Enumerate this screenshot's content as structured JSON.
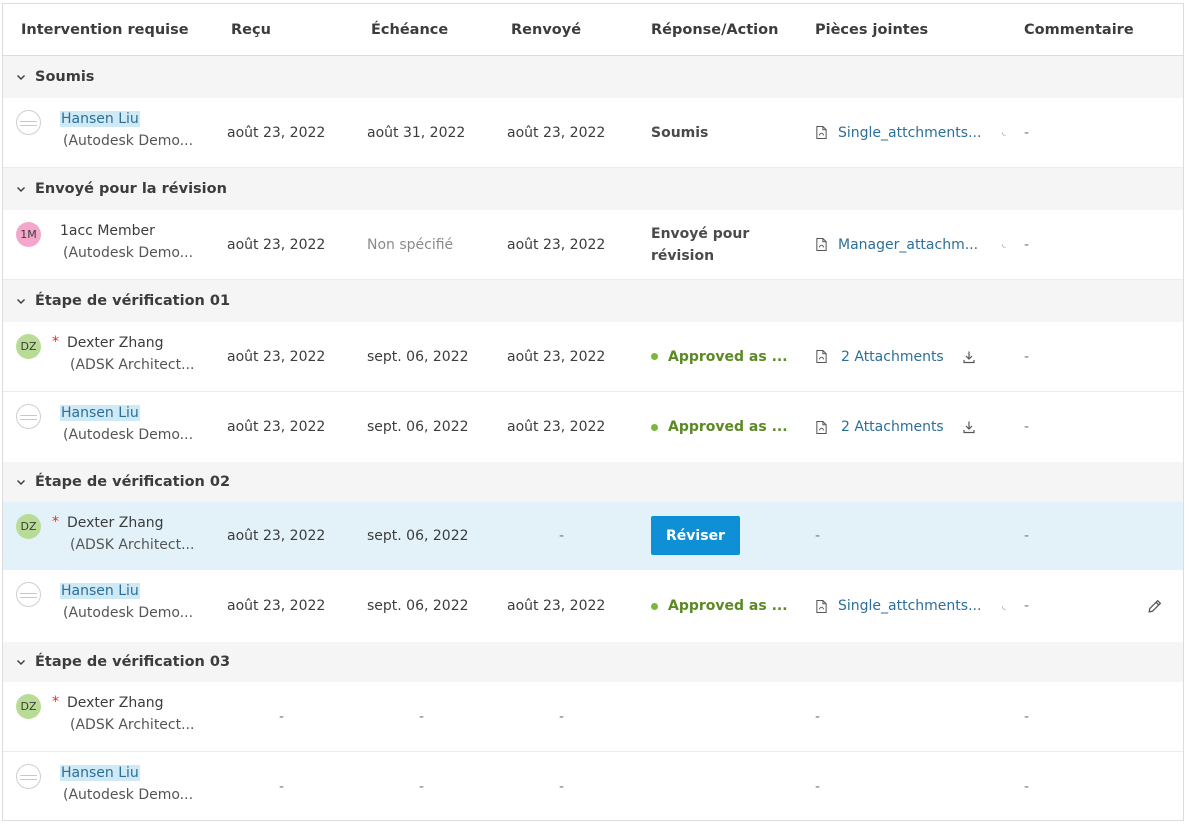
{
  "columns": {
    "intervention": "Intervention requise",
    "recu": "Reçu",
    "echeance": "Échéance",
    "renvoye": "Renvoyé",
    "reponse": "Réponse/Action",
    "pieces": "Pièces jointes",
    "commentaire": "Commentaire"
  },
  "groups": [
    {
      "label": "Soumis",
      "rows": [
        {
          "avatar": "",
          "name": "Hansen Liu",
          "org": "(Autodesk Demo...",
          "recu": "août 23, 2022",
          "echeance": "août 31, 2022",
          "renvoye": "août 23, 2022",
          "reponse": "Soumis",
          "attachment": "Single_attchments...",
          "commentaire": "-"
        }
      ]
    },
    {
      "label": "Envoyé pour la révision",
      "rows": [
        {
          "avatar": "1M",
          "name": "1acc Member",
          "org": "(Autodesk Demo...",
          "recu": "août 23, 2022",
          "echeance": "Non spécifié",
          "renvoye": "août 23, 2022",
          "reponse_line1": "Envoyé pour",
          "reponse_line2": "révision",
          "attachment": "Manager_attachm...",
          "commentaire": "-"
        }
      ]
    },
    {
      "label": "Étape de vérification 01",
      "rows": [
        {
          "avatar": "DZ",
          "name": "Dexter Zhang",
          "org": "(ADSK Architect...",
          "recu": "août 23, 2022",
          "echeance": "sept. 06, 2022",
          "renvoye": "août 23, 2022",
          "reponse": "Approved as ...",
          "attachment": "2 Attachments",
          "commentaire": "-"
        },
        {
          "avatar": "",
          "name": "Hansen Liu",
          "org": "(Autodesk Demo...",
          "recu": "août 23, 2022",
          "echeance": "sept. 06, 2022",
          "renvoye": "août 23, 2022",
          "reponse": "Approved as ...",
          "attachment": "2 Attachments",
          "commentaire": "-"
        }
      ]
    },
    {
      "label": "Étape de vérification 02",
      "rows": [
        {
          "avatar": "DZ",
          "name": "Dexter Zhang",
          "org": "(ADSK Architect...",
          "recu": "août 23, 2022",
          "echeance": "sept. 06, 2022",
          "renvoye": "-",
          "button": "Réviser",
          "attachment": "-",
          "commentaire": "-"
        },
        {
          "avatar": "",
          "name": "Hansen Liu",
          "org": "(Autodesk Demo...",
          "recu": "août 23, 2022",
          "echeance": "sept. 06, 2022",
          "renvoye": "août 23, 2022",
          "reponse": "Approved as ...",
          "attachment": "Single_attchments...",
          "commentaire": "-"
        }
      ]
    },
    {
      "label": "Étape de vérification 03",
      "rows": [
        {
          "avatar": "DZ",
          "name": "Dexter Zhang",
          "org": "(ADSK Architect...",
          "recu": "-",
          "echeance": "-",
          "renvoye": "-",
          "attachment": "-",
          "commentaire": "-"
        },
        {
          "avatar": "",
          "name": "Hansen Liu",
          "org": "(Autodesk Demo...",
          "recu": "-",
          "echeance": "-",
          "renvoye": "-",
          "attachment": "-",
          "commentaire": "-"
        }
      ]
    }
  ],
  "colors": {
    "accent": "#0f8fd6",
    "link": "#2b6f9a",
    "approved": "#5a8a23",
    "highlight_row": "#e3f2f9",
    "group_bg": "#f5f5f5",
    "avatar_dz": "#b8dc95",
    "avatar_1m": "#f4a7cb"
  },
  "icons": {
    "chevron": "chevron-down-icon",
    "file": "pdf-file-icon",
    "download": "download-icon",
    "edit": "pencil-edit-icon"
  }
}
